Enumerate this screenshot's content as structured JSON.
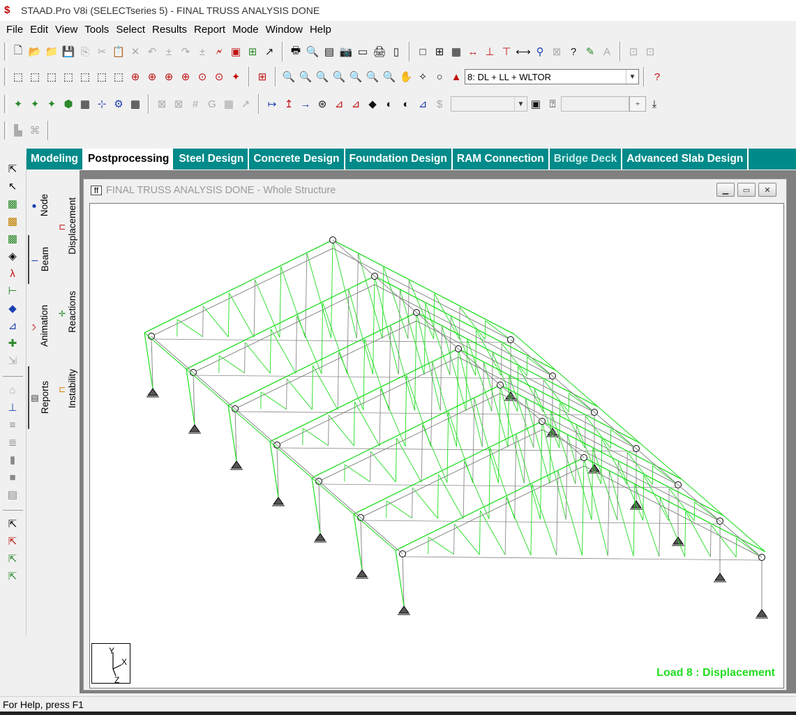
{
  "window": {
    "title": "STAAD.Pro V8i (SELECTseries 5) - FINAL TRUSS ANALYSIS DONE"
  },
  "menu": [
    "File",
    "Edit",
    "View",
    "Tools",
    "Select",
    "Results",
    "Report",
    "Mode",
    "Window",
    "Help"
  ],
  "load_case": {
    "selected": "8: DL + LL + WLTOR"
  },
  "page_tabs": [
    "Modeling",
    "Postprocessing",
    "Steel Design",
    "Concrete Design",
    "Foundation Design",
    "RAM Connection",
    "Bridge Deck",
    "Advanced Slab Design"
  ],
  "active_page_tab": "Postprocessing",
  "side_tabs_outer": [
    "Node",
    "Beam",
    "Animation",
    "Reports"
  ],
  "side_tabs_inner": [
    "Displacement",
    "Reactions",
    "Instability"
  ],
  "document": {
    "title": "FINAL TRUSS ANALYSIS DONE - Whole Structure",
    "load_label": "Load 8 : Displacement",
    "axis": {
      "y": "Y",
      "x": "X",
      "z": "Z"
    }
  },
  "status": {
    "text": "For Help, press F1"
  },
  "colors": {
    "tab_bar": "#008a8a",
    "truss_displaced": "#22dd22",
    "truss_original": "#888888"
  }
}
